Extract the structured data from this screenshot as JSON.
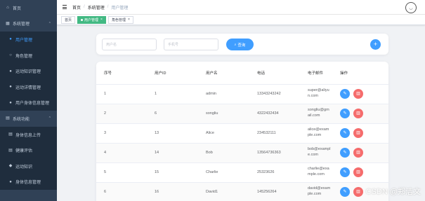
{
  "sidebar": {
    "home": {
      "icon": "home-icon",
      "label": "首页"
    },
    "groups": [
      {
        "icon": "system-icon",
        "label": "系统管理",
        "items": [
          {
            "icon": "user-icon",
            "label": "用户管理",
            "active": true
          },
          {
            "icon": "role-icon",
            "label": "角色管理"
          },
          {
            "icon": "user-icon",
            "label": "运动知识管理"
          },
          {
            "icon": "user-icon",
            "label": "运动详情管理"
          },
          {
            "icon": "user-icon",
            "label": "用户身体信息管理"
          }
        ]
      },
      {
        "icon": "document-icon",
        "label": "系统功能",
        "items": [
          {
            "icon": "document-icon",
            "label": "身体信息上传"
          },
          {
            "icon": "document-icon",
            "label": "健康评估"
          },
          {
            "icon": "location-icon",
            "label": "运动知识"
          },
          {
            "icon": "user-icon",
            "label": "身体信息管理"
          }
        ]
      }
    ]
  },
  "header": {
    "breadcrumb": [
      "首页",
      "系统管理",
      "用户管理"
    ],
    "separator": "/"
  },
  "tags": [
    {
      "label": "首页",
      "active": false
    },
    {
      "label": "用户管理",
      "active": true
    },
    {
      "label": "角色管理",
      "active": false
    }
  ],
  "search": {
    "username_placeholder": "用户名",
    "phone_placeholder": "手机号",
    "search_label": "查询",
    "add_label": "+"
  },
  "table": {
    "columns": [
      "序号",
      "用户ID",
      "用户名",
      "电话",
      "电子邮件",
      "操作"
    ],
    "rows": [
      {
        "index": "1",
        "user_id": "1",
        "username": "admin",
        "phone": "13343243242",
        "email": "super@aliyun.com"
      },
      {
        "index": "2",
        "user_id": "6",
        "username": "songliu",
        "phone": "4322432434",
        "email": "songliu@gmail.com"
      },
      {
        "index": "3",
        "user_id": "13",
        "username": "Alice",
        "phone": "234532111",
        "email": "alice@example.com"
      },
      {
        "index": "4",
        "user_id": "14",
        "username": "Bob",
        "phone": "13564736363",
        "email": "bob@example.com"
      },
      {
        "index": "5",
        "user_id": "15",
        "username": "Charlie",
        "phone": "25323626",
        "email": "charlie@example.com"
      },
      {
        "index": "6",
        "user_id": "16",
        "username": "David1",
        "phone": "145256264",
        "email": "david@example.com"
      }
    ]
  },
  "watermark": "CSDN @郑洁文",
  "colors": {
    "primary": "#409eff",
    "danger": "#f56c6c",
    "sidebar": "#304156",
    "tag_active": "#42b983"
  }
}
